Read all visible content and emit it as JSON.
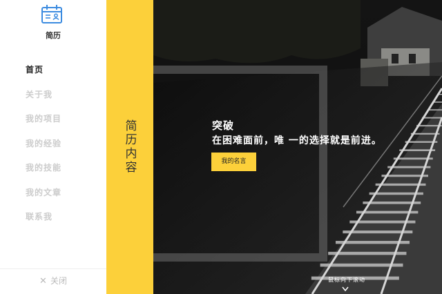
{
  "sidebar": {
    "logo_text": "简历",
    "logo_icon": "calendar-profile-icon",
    "nav": [
      {
        "label": "首页",
        "active": true
      },
      {
        "label": "关于我",
        "active": false
      },
      {
        "label": "我的项目",
        "active": false
      },
      {
        "label": "我的经验",
        "active": false
      },
      {
        "label": "我的技能",
        "active": false
      },
      {
        "label": "我的文章",
        "active": false
      },
      {
        "label": "联系我",
        "active": false
      }
    ],
    "close_label": "关闭",
    "close_icon": "close-x-icon"
  },
  "strip": {
    "title": "简历内容"
  },
  "hero": {
    "title": "突破",
    "subtitle": "在困难面前，唯 一的选择就是前进。",
    "button_label": "我的名言",
    "scroll_hint": "鼠标向下滚动",
    "scroll_icon": "chevron-down-icon"
  },
  "colors": {
    "accent": "#fcd03a",
    "sidebar_bg": "#ffffff",
    "nav_active": "#222222",
    "nav_inactive": "#cccccc"
  }
}
